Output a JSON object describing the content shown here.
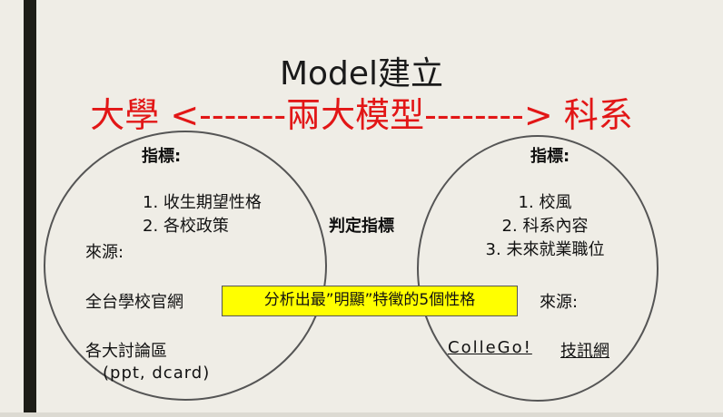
{
  "slide": {
    "title": "Model建立",
    "subtitle": "大學 <-------兩大模型--------> 科系",
    "middle_label": "判定指標",
    "highlight": "分析出最”明顯”特徵的5個性格",
    "left": {
      "heading": "指標:",
      "items": [
        "1. 收生期望性格",
        "2. 各校政策"
      ],
      "source_label": "來源:",
      "sources": [
        "全台學校官網",
        "各大討論區",
        "(ppt, dcard)"
      ]
    },
    "right": {
      "heading": "指標:",
      "items": [
        "1. 校風",
        "2. 科系內容",
        "3. 未來就業職位"
      ],
      "source_label": "來源:",
      "sources": [
        "ColleGo!",
        "技訊網"
      ]
    }
  },
  "colors": {
    "background": "#efede6",
    "left_bar": "#1d1d17",
    "subtitle": "#e21616",
    "highlight": "#ffff00",
    "circle_stroke": "#555555"
  }
}
